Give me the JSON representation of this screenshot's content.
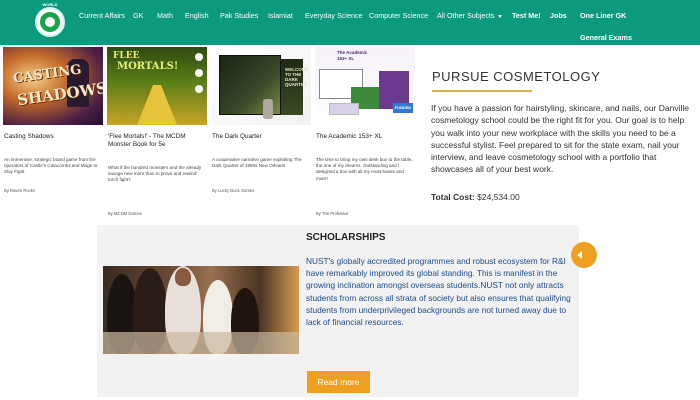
{
  "nav": {
    "logo_text": "WORLD",
    "items": [
      {
        "label": "Current Affairs"
      },
      {
        "label": "GK"
      },
      {
        "label": "Math"
      },
      {
        "label": "English"
      },
      {
        "label": "Pak Studies"
      },
      {
        "label": "Islamiat"
      },
      {
        "label": "Everyday Science"
      },
      {
        "label": "Computer Science"
      },
      {
        "label": "All Other Subjects"
      },
      {
        "label": "Test Me!"
      },
      {
        "label": "Jobs"
      },
      {
        "label": "One Liner GK"
      },
      {
        "label": "General Exams"
      }
    ]
  },
  "cards": [
    {
      "art_line1": "CASTING",
      "art_line2": "SHADOWS",
      "title": "Casting Shadows",
      "desc": "An immersive, strategic board game from the operators of Castle's Catacombs and Mage to Slay Fight",
      "by": "By Raven Rocks"
    },
    {
      "art_line1": "FLEE",
      "art_line2": "MORTALS!",
      "title": "'Flee Mortals!' - The MCDM Monster Book for 5e",
      "desc": "What if the hundred monsters and the already savage new more than to prove and rewind: torch fight?",
      "by": "By MCDM Games"
    },
    {
      "art_label": "WELCOME TO THE DARK QUARTER",
      "title": "The Dark Quarter",
      "desc": "A cooperative narrative game exploiting The Dark Quarter of 1980s New Orleans",
      "by": "By Lucky Duck Games"
    },
    {
      "art_label": "The Academic 153+ XL",
      "art_flag": "FUNDED",
      "title": "The Academic 153+ XL",
      "desc": "The time to bring my own desk box to the table, the one of my dreams. Outstanding and I designed a box with all my must-haves and more!",
      "by": "By The Professor"
    }
  ],
  "pursue": {
    "title": "PURSUE COSMETOLOGY",
    "text": "If you have a passion for hairstyling, skincare, and nails, our Danville cosmetology school could be the right fit for you. Our goal is to help you walk into your new workplace with the skills you need to be a successful stylist. Feel prepared to sit for the state exam, nail your interview, and leave cosmetology school with a portfolio that showcases all of your best work.",
    "cost_label": "Total Cost:",
    "cost_value": "$24,534.00"
  },
  "scholarships": {
    "title": "SCHOLARSHIPS",
    "text": "NUST's globally accredited programmes and robust ecosystem for R&I have remarkably improved its global standing. This is manifest in the growing inclination amongst overseas students.NUST not only attracts students from across all strata of society but also ensures that qualifying students from underprivileged backgrounds are not turned away due to lack of financial resources.",
    "button": "Read more"
  },
  "colors": {
    "nav_bg": "#0b9a7c",
    "accent_orange": "#f0a020",
    "link_blue": "#1f4a8a",
    "rule_gold": "#d9b44a"
  }
}
